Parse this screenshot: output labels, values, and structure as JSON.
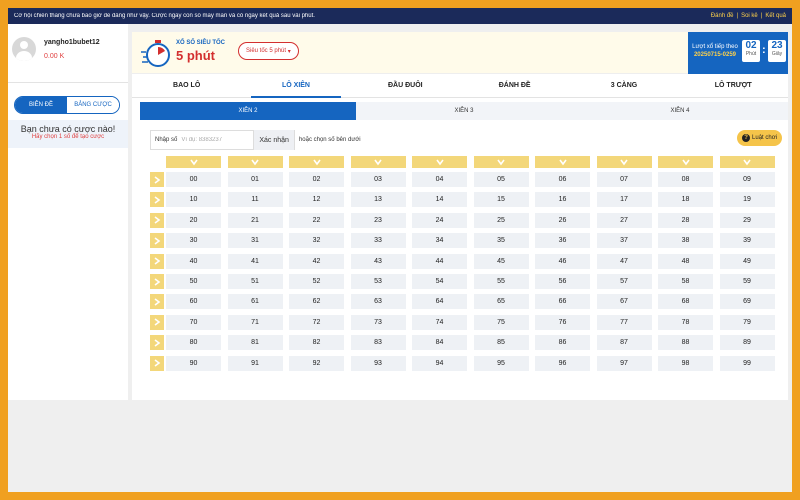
{
  "topbar": {
    "message": "Cơ hội chiến thắng chưa bao giờ dễ dàng như vậy. Cược ngay con số may mắn và có ngay kết quả sau vài phút.",
    "links": [
      "Đánh đề",
      "Soi kê",
      "Kết quả"
    ]
  },
  "user": {
    "name": "yangho1bubet12",
    "balance": "0.00 K"
  },
  "left_tabs": [
    "BIÊN ĐỀ",
    "BẢNG CƯỢC"
  ],
  "no_bet": {
    "title": "Bạn chưa có cược nào!",
    "hint": "Hãy chọn 1 số để tạo cược"
  },
  "header": {
    "subtitle": "XỔ SỐ SIÊU TỐC",
    "title": "5 phút",
    "speed_select": "Siêu tốc 5 phút",
    "next_draw_label": "Lượt xổ tiếp theo",
    "next_draw_code": "20250715-0259",
    "minutes": "02",
    "minutes_label": "Phút",
    "seconds": "23",
    "seconds_label": "Giây"
  },
  "tabs": [
    "BAO LÔ",
    "LÔ XIÊN",
    "ĐẦU ĐUÔI",
    "ĐÁNH ĐỀ",
    "3 CÀNG",
    "LÔ TRƯỢT"
  ],
  "active_tab": 1,
  "subtabs": [
    "XIÊN 2",
    "XIÊN 3",
    "XIÊN 4"
  ],
  "active_subtab": 0,
  "input": {
    "label": "Nhập số",
    "placeholder": "Ví dụ: 8383237",
    "confirm": "Xác nhận",
    "or_pick": "hoặc chọn số bên dưới"
  },
  "rules_button": "Luật chơi",
  "grid": [
    [
      "00",
      "01",
      "02",
      "03",
      "04",
      "05",
      "06",
      "07",
      "08",
      "09"
    ],
    [
      "10",
      "11",
      "12",
      "13",
      "14",
      "15",
      "16",
      "17",
      "18",
      "19"
    ],
    [
      "20",
      "21",
      "22",
      "23",
      "24",
      "25",
      "26",
      "27",
      "28",
      "29"
    ],
    [
      "30",
      "31",
      "32",
      "33",
      "34",
      "35",
      "36",
      "37",
      "38",
      "39"
    ],
    [
      "40",
      "41",
      "42",
      "43",
      "44",
      "45",
      "46",
      "47",
      "48",
      "49"
    ],
    [
      "50",
      "51",
      "52",
      "53",
      "54",
      "55",
      "56",
      "57",
      "58",
      "59"
    ],
    [
      "60",
      "61",
      "62",
      "63",
      "64",
      "65",
      "66",
      "67",
      "68",
      "69"
    ],
    [
      "70",
      "71",
      "72",
      "73",
      "74",
      "75",
      "76",
      "77",
      "78",
      "79"
    ],
    [
      "80",
      "81",
      "82",
      "83",
      "84",
      "85",
      "86",
      "87",
      "88",
      "89"
    ],
    [
      "90",
      "91",
      "92",
      "93",
      "94",
      "95",
      "96",
      "97",
      "98",
      "99"
    ]
  ],
  "colors": {
    "primary": "#1565c0",
    "accent": "#d32f2f",
    "gold": "#f3d77a",
    "frame": "#f0a020"
  }
}
